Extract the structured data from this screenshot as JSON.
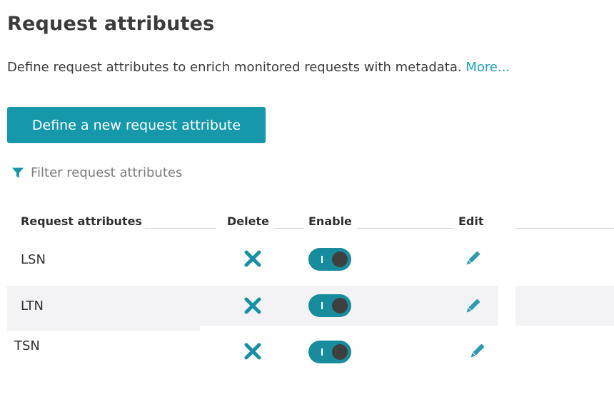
{
  "page": {
    "title": "Request attributes",
    "description": "Define request attributes to enrich monitored requests with metadata.",
    "more_link": "More..."
  },
  "actions": {
    "define_button": "Define a new request attribute"
  },
  "filter": {
    "placeholder": "Filter request attributes",
    "icon": "filter-funnel-icon"
  },
  "table": {
    "headers": {
      "name": "Request attributes",
      "delete": "Delete",
      "enable": "Enable",
      "edit": "Edit"
    },
    "rows": [
      {
        "name": "LSN",
        "enabled": true
      },
      {
        "name": "LTN",
        "enabled": true
      },
      {
        "name": "TSN",
        "enabled": true
      }
    ]
  },
  "colors": {
    "accent": "#1598aa",
    "link": "#1aa2b7",
    "delete_icon": "#1590a4",
    "toggle_on": "#168c9c",
    "edit_icon": "#2a9bb0",
    "row_alt": "#f3f3f5"
  }
}
